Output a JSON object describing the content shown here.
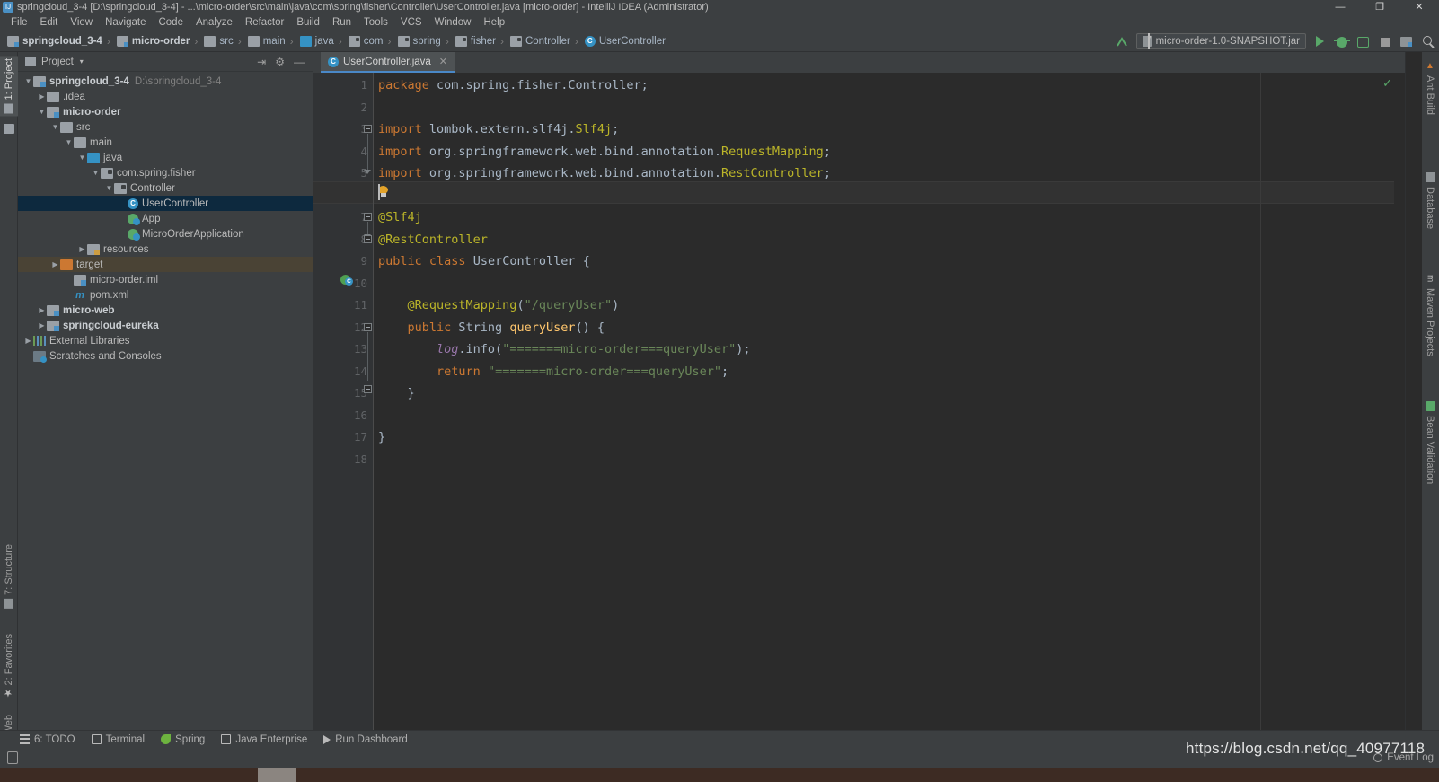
{
  "window": {
    "title": "springcloud_3-4 [D:\\springcloud_3-4] - ...\\micro-order\\src\\main\\java\\com\\spring\\fisher\\Controller\\UserController.java [micro-order] - IntelliJ IDEA (Administrator)",
    "minimize": "—",
    "maximize": "❐",
    "close": "✕"
  },
  "menu": {
    "items": [
      "File",
      "Edit",
      "View",
      "Navigate",
      "Code",
      "Analyze",
      "Refactor",
      "Build",
      "Run",
      "Tools",
      "VCS",
      "Window",
      "Help"
    ]
  },
  "breadcrumb": {
    "items": [
      {
        "label": "springcloud_3-4",
        "icon": "module-icon",
        "bold": true
      },
      {
        "label": "micro-order",
        "icon": "module-icon",
        "bold": true
      },
      {
        "label": "src",
        "icon": "folder-icon",
        "bold": false
      },
      {
        "label": "main",
        "icon": "folder-icon",
        "bold": false
      },
      {
        "label": "java",
        "icon": "source-folder-icon",
        "bold": false
      },
      {
        "label": "com",
        "icon": "package-icon",
        "bold": false
      },
      {
        "label": "spring",
        "icon": "package-icon",
        "bold": false
      },
      {
        "label": "fisher",
        "icon": "package-icon",
        "bold": false
      },
      {
        "label": "Controller",
        "icon": "package-icon",
        "bold": false
      },
      {
        "label": "UserController",
        "icon": "class-icon",
        "bold": false
      }
    ]
  },
  "toolbar": {
    "run_configuration": "micro-order-1.0-SNAPSHOT.jar",
    "caret": "▾",
    "buttons": [
      "run-button",
      "debug-button",
      "run-with-coverage-button",
      "stop-button",
      "project-structure-button",
      "search-everywhere-button"
    ]
  },
  "left_tool_tabs": [
    {
      "label": "1: Project",
      "selected": true
    },
    {
      "label": "7: Structure",
      "selected": false
    },
    {
      "label": "2: Favorites",
      "selected": false
    },
    {
      "label": "Web",
      "selected": false
    }
  ],
  "right_tool_tabs": [
    {
      "label": "Ant Build"
    },
    {
      "label": "Database"
    },
    {
      "label": "Maven Projects"
    },
    {
      "label": "Bean Validation"
    }
  ],
  "project_panel": {
    "title": "Project",
    "caret": "▾",
    "actions": [
      "collapse-all-icon",
      "settings-gear-icon",
      "hide-icon"
    ],
    "tree": [
      {
        "label": "springcloud_3-4",
        "sub": "D:\\springcloud_3-4",
        "indent": 0,
        "arrow": "▼",
        "icon": "module-icon",
        "bold": true,
        "state": "none"
      },
      {
        "label": ".idea",
        "sub": "",
        "indent": 1,
        "arrow": "▶",
        "icon": "folder-icon",
        "bold": false,
        "state": "none"
      },
      {
        "label": "micro-order",
        "sub": "",
        "indent": 1,
        "arrow": "▼",
        "icon": "module-icon",
        "bold": true,
        "state": "none"
      },
      {
        "label": "src",
        "sub": "",
        "indent": 2,
        "arrow": "▼",
        "icon": "folder-icon",
        "bold": false,
        "state": "none"
      },
      {
        "label": "main",
        "sub": "",
        "indent": 3,
        "arrow": "▼",
        "icon": "folder-icon",
        "bold": false,
        "state": "none"
      },
      {
        "label": "java",
        "sub": "",
        "indent": 4,
        "arrow": "▼",
        "icon": "source-folder-icon",
        "bold": false,
        "state": "none"
      },
      {
        "label": "com.spring.fisher",
        "sub": "",
        "indent": 5,
        "arrow": "▼",
        "icon": "package-icon",
        "bold": false,
        "state": "none"
      },
      {
        "label": "Controller",
        "sub": "",
        "indent": 6,
        "arrow": "▼",
        "icon": "package-icon",
        "bold": false,
        "state": "none"
      },
      {
        "label": "UserController",
        "sub": "",
        "indent": 7,
        "arrow": "",
        "icon": "class-icon",
        "bold": false,
        "state": "selected"
      },
      {
        "label": "App",
        "sub": "",
        "indent": 7,
        "arrow": "",
        "icon": "runnable-class-icon",
        "bold": false,
        "state": "none"
      },
      {
        "label": "MicroOrderApplication",
        "sub": "",
        "indent": 7,
        "arrow": "",
        "icon": "runnable-class-icon",
        "bold": false,
        "state": "none"
      },
      {
        "label": "resources",
        "sub": "",
        "indent": 4,
        "arrow": "▶",
        "icon": "resources-folder-icon",
        "bold": false,
        "state": "none"
      },
      {
        "label": "target",
        "sub": "",
        "indent": 2,
        "arrow": "▶",
        "icon": "excluded-folder-icon",
        "bold": false,
        "state": "highlight"
      },
      {
        "label": "micro-order.iml",
        "sub": "",
        "indent": 3,
        "arrow": "",
        "icon": "iml-file-icon",
        "bold": false,
        "state": "none"
      },
      {
        "label": "pom.xml",
        "sub": "",
        "indent": 3,
        "arrow": "",
        "icon": "maven-file-icon",
        "bold": false,
        "state": "none"
      },
      {
        "label": "micro-web",
        "sub": "",
        "indent": 1,
        "arrow": "▶",
        "icon": "module-icon",
        "bold": true,
        "state": "none"
      },
      {
        "label": "springcloud-eureka",
        "sub": "",
        "indent": 1,
        "arrow": "▶",
        "icon": "module-icon",
        "bold": true,
        "state": "none"
      },
      {
        "label": "External Libraries",
        "sub": "",
        "indent": 0,
        "arrow": "▶",
        "icon": "library-icon",
        "bold": false,
        "state": "none"
      },
      {
        "label": "Scratches and Consoles",
        "sub": "",
        "indent": 0,
        "arrow": "",
        "icon": "scratches-icon",
        "bold": false,
        "state": "none"
      }
    ]
  },
  "editor": {
    "tab": {
      "label": "UserController.java",
      "icon": "java-class-icon",
      "close": "✕"
    },
    "inspection_status": "✓",
    "line_numbers": [
      "1",
      "2",
      "3",
      "4",
      "5",
      "6",
      "7",
      "8",
      "9",
      "10",
      "11",
      "12",
      "13",
      "14",
      "15",
      "16",
      "17",
      "18"
    ],
    "caret_line": 6,
    "code_lines": [
      {
        "n": 1,
        "tokens": [
          {
            "t": "package ",
            "c": "kw"
          },
          {
            "t": "com.spring.fisher.Controller;",
            "c": "plain"
          }
        ]
      },
      {
        "n": 2,
        "tokens": []
      },
      {
        "n": 3,
        "tokens": [
          {
            "t": "import ",
            "c": "kw"
          },
          {
            "t": "lombok.extern.slf4j.",
            "c": "plain"
          },
          {
            "t": "Slf4j",
            "c": "ann"
          },
          {
            "t": ";",
            "c": "plain"
          }
        ]
      },
      {
        "n": 4,
        "tokens": [
          {
            "t": "import ",
            "c": "kw"
          },
          {
            "t": "org.springframework.web.bind.annotation.",
            "c": "plain"
          },
          {
            "t": "RequestMapping",
            "c": "ann"
          },
          {
            "t": ";",
            "c": "plain"
          }
        ]
      },
      {
        "n": 5,
        "tokens": [
          {
            "t": "import ",
            "c": "kw"
          },
          {
            "t": "org.springframework.web.bind.annotation.",
            "c": "plain"
          },
          {
            "t": "RestController",
            "c": "ann"
          },
          {
            "t": ";",
            "c": "plain"
          }
        ]
      },
      {
        "n": 6,
        "tokens": []
      },
      {
        "n": 7,
        "tokens": [
          {
            "t": "@Slf4j",
            "c": "ann"
          }
        ]
      },
      {
        "n": 8,
        "tokens": [
          {
            "t": "@RestController",
            "c": "ann"
          }
        ]
      },
      {
        "n": 9,
        "tokens": [
          {
            "t": "public ",
            "c": "kw"
          },
          {
            "t": "class ",
            "c": "kw"
          },
          {
            "t": "UserController",
            "c": "cls-name"
          },
          {
            "t": " {",
            "c": "plain"
          }
        ]
      },
      {
        "n": 10,
        "tokens": []
      },
      {
        "n": 11,
        "tokens": [
          {
            "t": "    @RequestMapping",
            "c": "ann"
          },
          {
            "t": "(",
            "c": "plain"
          },
          {
            "t": "\"/queryUser\"",
            "c": "str"
          },
          {
            "t": ")",
            "c": "plain"
          }
        ]
      },
      {
        "n": 12,
        "tokens": [
          {
            "t": "    ",
            "c": "plain"
          },
          {
            "t": "public ",
            "c": "kw"
          },
          {
            "t": "String ",
            "c": "cls-name"
          },
          {
            "t": "queryUser",
            "c": "meth"
          },
          {
            "t": "() {",
            "c": "plain"
          }
        ]
      },
      {
        "n": 13,
        "tokens": [
          {
            "t": "        ",
            "c": "plain"
          },
          {
            "t": "log",
            "c": "fld"
          },
          {
            "t": ".info(",
            "c": "plain"
          },
          {
            "t": "\"=======micro-order===queryUser\"",
            "c": "str"
          },
          {
            "t": ");",
            "c": "plain"
          }
        ]
      },
      {
        "n": 14,
        "tokens": [
          {
            "t": "        ",
            "c": "plain"
          },
          {
            "t": "return ",
            "c": "kw"
          },
          {
            "t": "\"=======micro-order===queryUser\"",
            "c": "str"
          },
          {
            "t": ";",
            "c": "plain"
          }
        ]
      },
      {
        "n": 15,
        "tokens": [
          {
            "t": "    }",
            "c": "plain"
          }
        ]
      },
      {
        "n": 16,
        "tokens": []
      },
      {
        "n": 17,
        "tokens": [
          {
            "t": "}",
            "c": "plain"
          }
        ]
      },
      {
        "n": 18,
        "tokens": []
      }
    ]
  },
  "bottom_tabs": [
    {
      "label": "6: TODO",
      "icon": "todo-icon"
    },
    {
      "label": "Terminal",
      "icon": "terminal-icon"
    },
    {
      "label": "Spring",
      "icon": "spring-leaf-icon"
    },
    {
      "label": "Java Enterprise",
      "icon": "java-enterprise-icon"
    },
    {
      "label": "Run Dashboard",
      "icon": "run-dashboard-icon"
    }
  ],
  "status_bar": {
    "left_icon": "toggle-toolbar-icon",
    "event_log": "Event Log"
  },
  "watermark": "https://blog.csdn.net/qq_40977118",
  "colors": {
    "chrome_bg": "#3c3f41",
    "editor_bg": "#2b2b2b",
    "gutter_bg": "#313335",
    "selection_bg": "#0d293e",
    "tab_accent": "#4a88c7",
    "keyword": "#cc7832",
    "annotation": "#bbb529",
    "string": "#6a8759",
    "field": "#9876aa",
    "method": "#ffc66d",
    "default_text": "#a9b7c6",
    "run_green": "#59a869"
  }
}
